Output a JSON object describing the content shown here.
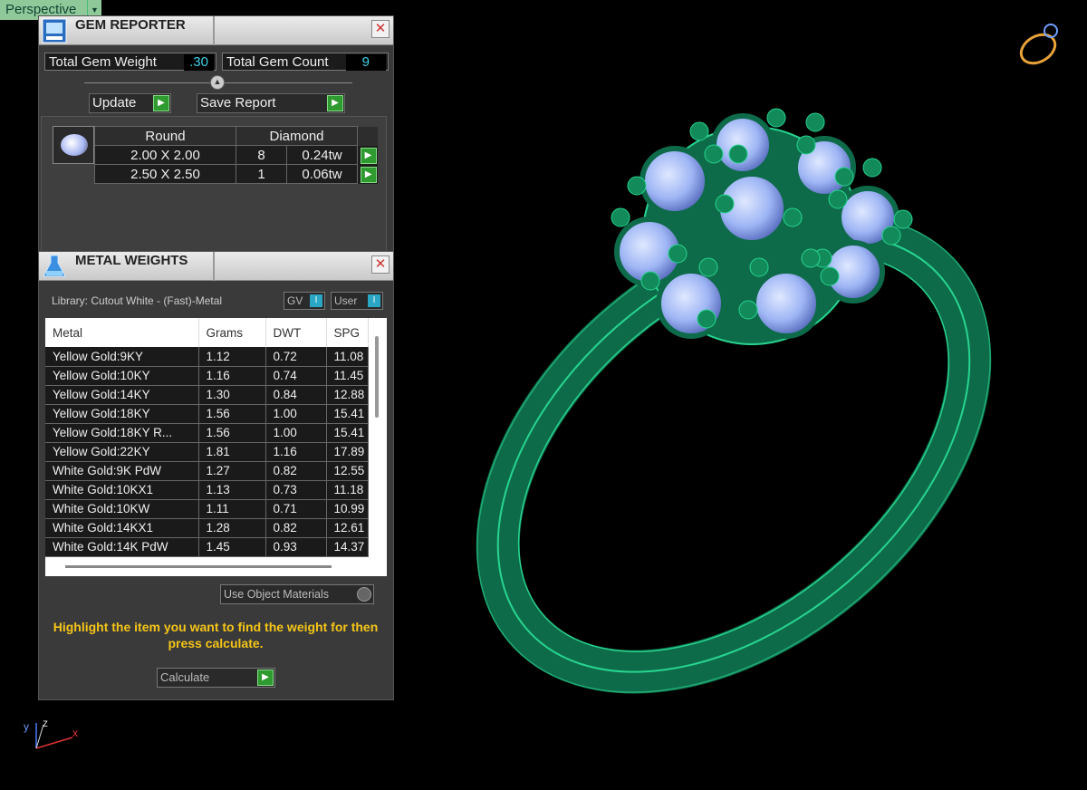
{
  "viewport": {
    "label": "Perspective",
    "dropdown_icon": "chevron-down-icon"
  },
  "gem_reporter": {
    "title": "GEM REPORTER",
    "icon": "gem-report-icon",
    "close": "✕",
    "total_weight_label": "Total Gem Weight",
    "total_weight_value": ".30",
    "total_count_label": "Total Gem Count",
    "total_count_value": "9",
    "update_label": "Update",
    "save_label": "Save Report",
    "header": {
      "shape": "Round",
      "type": "Diamond"
    },
    "rows": [
      {
        "size": "2.00 X 2.00",
        "count": "8",
        "weight": "0.24tw"
      },
      {
        "size": "2.50 X 2.50",
        "count": "1",
        "weight": "0.06tw"
      }
    ]
  },
  "metal_weights": {
    "title": "METAL WEIGHTS",
    "icon": "flask-icon",
    "close": "✕",
    "library": "Library: Cutout White - (Fast)-Metal",
    "gv_label": "GV",
    "user_label": "User",
    "columns": [
      "Metal",
      "Grams",
      "DWT",
      "SPG"
    ],
    "rows": [
      [
        "Yellow Gold:9KY",
        "1.12",
        "0.72",
        "11.08"
      ],
      [
        "Yellow Gold:10KY",
        "1.16",
        "0.74",
        "11.45"
      ],
      [
        "Yellow Gold:14KY",
        "1.30",
        "0.84",
        "12.88"
      ],
      [
        "Yellow Gold:18KY",
        "1.56",
        "1.00",
        "15.41"
      ],
      [
        "Yellow Gold:18KY R...",
        "1.56",
        "1.00",
        "15.41"
      ],
      [
        "Yellow Gold:22KY",
        "1.81",
        "1.16",
        "17.89"
      ],
      [
        "White Gold:9K PdW",
        "1.27",
        "0.82",
        "12.55"
      ],
      [
        "White Gold:10KX1",
        "1.13",
        "0.73",
        "11.18"
      ],
      [
        "White Gold:10KW",
        "1.11",
        "0.71",
        "10.99"
      ],
      [
        "White Gold:14KX1",
        "1.28",
        "0.82",
        "12.61"
      ],
      [
        "White Gold:14K PdW",
        "1.45",
        "0.93",
        "14.37"
      ]
    ],
    "use_object_materials": "Use Object Materials",
    "hint": "Highlight the item you want to find the weight for then press calculate.",
    "calculate_label": "Calculate"
  },
  "axis": {
    "x": "x",
    "y": "y",
    "z": "z"
  },
  "colors": {
    "ring": "#0e6b4a",
    "ring_edge": "#27d58f",
    "gem": "#9fb6f5",
    "accent_green": "#2f9a2f",
    "hint": "#f5c518"
  }
}
